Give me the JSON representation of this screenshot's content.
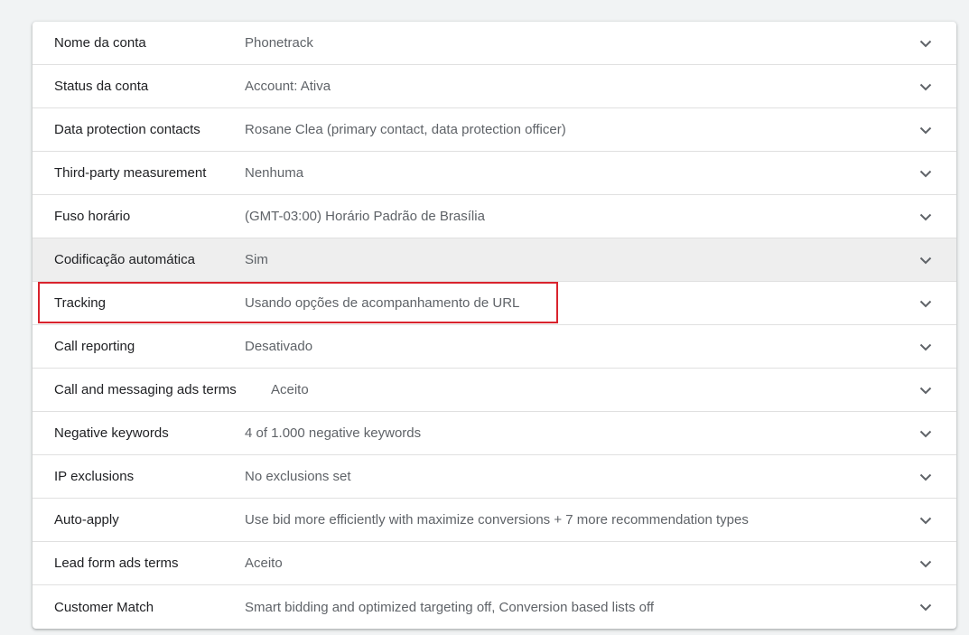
{
  "settings": {
    "rows": [
      {
        "label": "Nome da conta",
        "value": "Phonetrack"
      },
      {
        "label": "Status da conta",
        "value": "Account: Ativa"
      },
      {
        "label": "Data protection contacts",
        "value": "Rosane Clea (primary contact, data protection officer)"
      },
      {
        "label": "Third-party measurement",
        "value": "Nenhuma"
      },
      {
        "label": "Fuso horário",
        "value": "(GMT-03:00) Horário Padrão de Brasília"
      },
      {
        "label": "Codificação automática",
        "value": "Sim"
      },
      {
        "label": "Tracking",
        "value": "Usando opções de acompanhamento de URL"
      },
      {
        "label": "Call reporting",
        "value": "Desativado"
      },
      {
        "label": "Call and messaging ads terms",
        "value": "Aceito"
      },
      {
        "label": "Negative keywords",
        "value": "4 of 1.000 negative keywords"
      },
      {
        "label": "IP exclusions",
        "value": "No exclusions set"
      },
      {
        "label": "Auto-apply",
        "value": "Use bid more efficiently with maximize conversions + 7 more recommendation types"
      },
      {
        "label": "Lead form ads terms",
        "value": "Aceito"
      },
      {
        "label": "Customer Match",
        "value": "Smart bidding and optimized targeting off, Conversion based lists off"
      }
    ],
    "expand_icon": "chevron-down-icon",
    "hover_row_color": "#eeeeee",
    "highlight_color": "#d9232d"
  }
}
